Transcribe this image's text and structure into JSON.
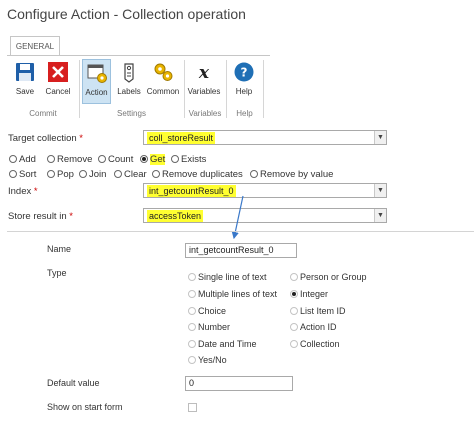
{
  "window": {
    "title": "Configure Action - Collection operation"
  },
  "ribbon": {
    "tab": "GENERAL",
    "buttons": {
      "save": "Save",
      "cancel": "Cancel",
      "action": "Action",
      "labels": "Labels",
      "common": "Common",
      "variables": "Variables",
      "help": "Help"
    },
    "groups": {
      "commit": "Commit",
      "settings": "Settings",
      "variables": "Variables",
      "help": "Help"
    }
  },
  "form": {
    "target_collection": {
      "label": "Target collection",
      "required": "*",
      "value": "coll_storeResult"
    },
    "operations": {
      "add": "Add",
      "remove": "Remove",
      "count": "Count",
      "get": "Get",
      "exists": "Exists",
      "sort": "Sort",
      "pop": "Pop",
      "join": "Join",
      "clear": "Clear",
      "remove_duplicates": "Remove duplicates",
      "remove_by_value": "Remove by value",
      "selected": "Get"
    },
    "index": {
      "label": "Index",
      "required": "*",
      "value": "int_getcountResult_0"
    },
    "store_result": {
      "label": "Store result in",
      "required": "*",
      "value": "accessToken"
    }
  },
  "details": {
    "name": {
      "label": "Name",
      "value": "int_getcountResult_0"
    },
    "type": {
      "label": "Type",
      "options": {
        "single_line": "Single line of text",
        "person": "Person or Group",
        "multi_line": "Multiple lines of text",
        "integer": "Integer",
        "choice": "Choice",
        "list_item_id": "List Item ID",
        "number": "Number",
        "action_id": "Action ID",
        "date_time": "Date and Time",
        "collection": "Collection",
        "yes_no": "Yes/No"
      },
      "selected": "Integer"
    },
    "default_value": {
      "label": "Default value",
      "value": "0"
    },
    "show_on_start": {
      "label": "Show on start form",
      "checked": false
    }
  },
  "colors": {
    "highlight": "#ffff31",
    "accent": "#1f6fb5",
    "selected_button": "#cde3f3"
  }
}
